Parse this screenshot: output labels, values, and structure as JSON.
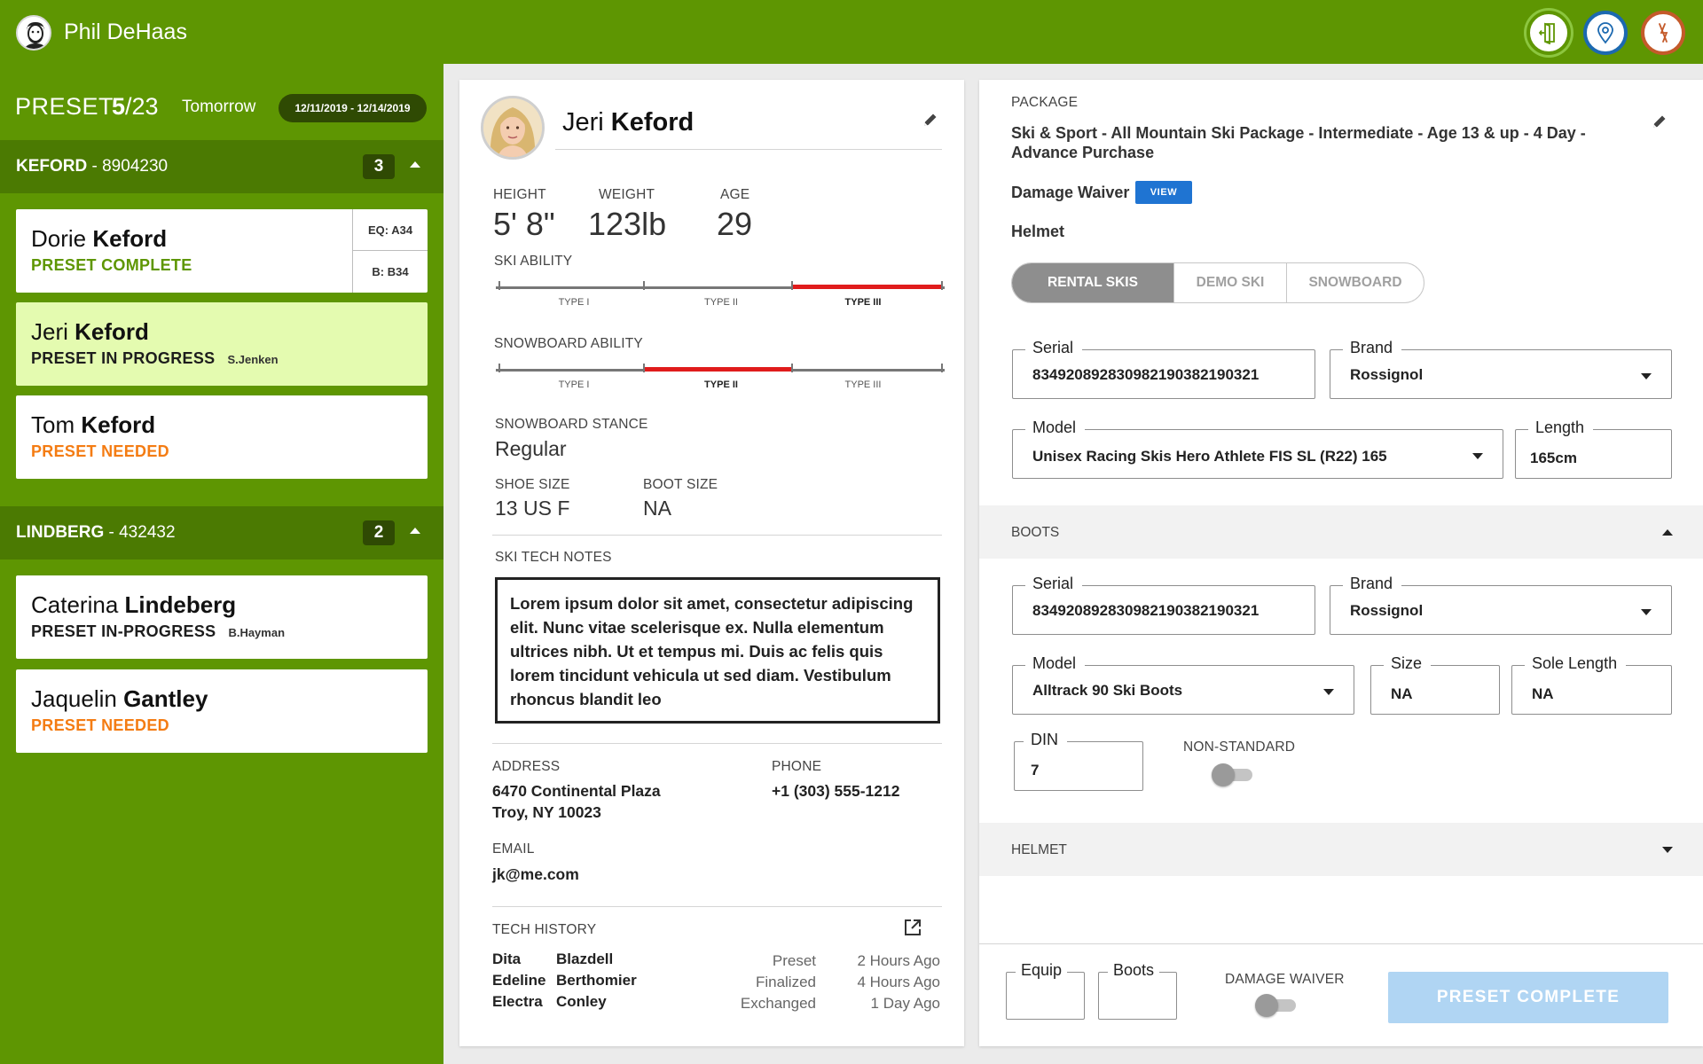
{
  "topbar": {
    "user_name": "Phil DeHaas",
    "icons": [
      "door-exit-icon",
      "location-pin-icon",
      "ski-icon"
    ],
    "colors": {
      "green": "#5e9602",
      "blue": "#1c69b0",
      "orange": "#c45a2a"
    }
  },
  "sidebar": {
    "preset_label": "PRESET",
    "preset_current": "5",
    "preset_total": "/23",
    "day": "Tomorrow",
    "date_range": "12/11/2019 - 12/14/2019",
    "groups": [
      {
        "last_name": "KEFORD",
        "id": " - 8904230",
        "count": "3",
        "people": [
          {
            "first": "Dorie ",
            "last": "Keford",
            "status": "PRESET COMPLETE",
            "eq": "EQ: A34",
            "b": "B: B34"
          },
          {
            "first": "Jeri ",
            "last": "Keford",
            "status": "PRESET IN PROGRESS",
            "tech": "S.Jenken"
          },
          {
            "first": "Tom ",
            "last": "Keford",
            "status": "PRESET NEEDED"
          }
        ]
      },
      {
        "last_name": "LINDBERG",
        "id": " - 432432",
        "count": "2",
        "people": [
          {
            "first": "Caterina ",
            "last": "Lindeberg",
            "status": "PRESET IN-PROGRESS",
            "tech": "B.Hayman"
          },
          {
            "first": "Jaquelin ",
            "last": "Gantley",
            "status": "PRESET NEEDED"
          }
        ]
      }
    ]
  },
  "profile": {
    "first_name": "Jeri ",
    "last_name": "Keford",
    "height_label": "HEIGHT",
    "height": "5' 8\"",
    "weight_label": "WEIGHT",
    "weight": "123lb",
    "age_label": "AGE",
    "age": "29",
    "ski_ability_label": "SKI ABILITY",
    "ski_ability": {
      "levels": [
        "TYPE I",
        "TYPE II",
        "TYPE III"
      ],
      "selected": "TYPE III"
    },
    "snowboard_ability_label": "SNOWBOARD ABILITY",
    "snowboard_ability": {
      "levels": [
        "TYPE I",
        "TYPE II",
        "TYPE III"
      ],
      "selected": "TYPE II"
    },
    "stance_label": "SNOWBOARD STANCE",
    "stance": "Regular",
    "shoe_label": "SHOE SIZE",
    "shoe": "13 US F",
    "boot_label": "BOOT SIZE",
    "boot": "NA",
    "notes_label": "SKI TECH NOTES",
    "notes": "Lorem ipsum dolor sit amet, consectetur adipiscing elit. Nunc vitae scelerisque ex. Nulla elementum ultrices nibh. Ut et tempus mi. Duis ac felis quis lorem tincidunt vehicula ut sed diam. Vestibulum rhoncus blandit leo",
    "address_label": "ADDRESS",
    "address_line1": "6470 Continental Plaza",
    "address_line2": "Troy, NY 10023",
    "phone_label": "PHONE",
    "phone": "+1 (303) 555-1212",
    "email_label": "EMAIL",
    "email": "jk@me.com",
    "history_label": "TECH HISTORY",
    "history": [
      {
        "first": "Dita",
        "last": "Blazdell",
        "action": "Preset",
        "when": "2 Hours Ago"
      },
      {
        "first": "Edeline",
        "last": "Berthomier",
        "action": "Finalized",
        "when": "4 Hours Ago"
      },
      {
        "first": "Electra",
        "last": "Conley",
        "action": "Exchanged",
        "when": "1 Day Ago"
      }
    ]
  },
  "equipment": {
    "package_label": "PACKAGE",
    "package": "Ski & Sport - All Mountain Ski Package - Intermediate - Age 13 & up - 4 Day - Advance Purchase",
    "damage_waiver": "Damage Waiver",
    "view_label": "VIEW",
    "helmet": "Helmet",
    "tabs": [
      "RENTAL SKIS",
      "DEMO SKI",
      "SNOWBOARD"
    ],
    "active_tab": "RENTAL SKIS",
    "ski": {
      "serial_label": "Serial",
      "serial": "834920892830982190382190321",
      "brand_label": "Brand",
      "brand": "Rossignol",
      "model_label": "Model",
      "model": "Unisex Racing Skis Hero Athlete FIS SL (R22) 165",
      "length_label": "Length",
      "length": "165cm"
    },
    "boots_label": "BOOTS",
    "boots": {
      "serial_label": "Serial",
      "serial": "834920892830982190382190321",
      "brand_label": "Brand",
      "brand": "Rossignol",
      "model_label": "Model",
      "model": "Alltrack 90 Ski Boots",
      "size_label": "Size",
      "size": "NA",
      "sole_label": "Sole Length",
      "sole": "NA",
      "din_label": "DIN",
      "din": "7",
      "nonstandard_label": "NON-STANDARD"
    },
    "helmet_label": "HELMET",
    "footer": {
      "equip_label": "Equip",
      "boots_label": "Boots",
      "damage_waiver_label": "DAMAGE WAIVER",
      "complete_label": "PRESET COMPLETE"
    }
  }
}
